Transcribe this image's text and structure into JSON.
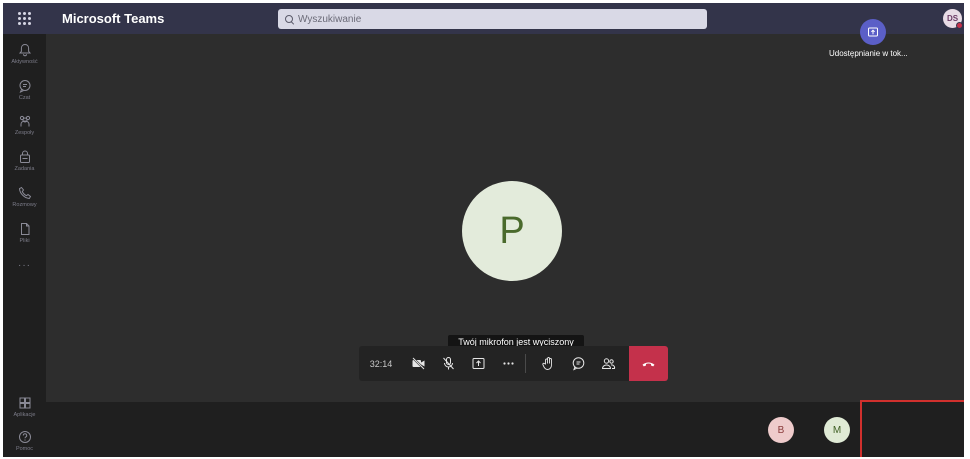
{
  "topbar": {
    "app_title": "Microsoft Teams",
    "search_placeholder": "Wyszukiwanie",
    "user_initials": "DS"
  },
  "rail": {
    "items": [
      {
        "label": "Aktywność",
        "icon": "bell-icon"
      },
      {
        "label": "Czat",
        "icon": "chat-icon"
      },
      {
        "label": "Zespoły",
        "icon": "teams-icon"
      },
      {
        "label": "Zadania",
        "icon": "assignments-icon"
      },
      {
        "label": "Rozmowy",
        "icon": "phone-icon"
      },
      {
        "label": "Pliki",
        "icon": "file-icon"
      }
    ],
    "more": "···",
    "apps_label": "Aplikacje",
    "help_label": "Pomoc"
  },
  "stage": {
    "participant_initial": "P",
    "tooltip": "Twój mikrofon jest wyciszony",
    "timer": "32:14"
  },
  "tray": {
    "participants": [
      {
        "initial": "B",
        "bg": "#eecbcb",
        "fg": "#8a3b3b"
      },
      {
        "initial": "M",
        "bg": "#dfead5",
        "fg": "#3e5f23"
      }
    ],
    "share_label": "Udostępnianie w tok..."
  },
  "colors": {
    "topbar": "#33344a",
    "accent": "#5b5fc7",
    "hangup": "#c4314b",
    "highlight_box": "#d0302d"
  }
}
